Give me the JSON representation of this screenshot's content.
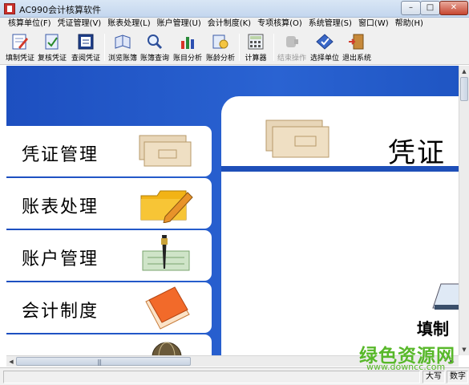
{
  "window": {
    "title": "AC990会计核算软件",
    "minimize_symbol": "–",
    "maximize_symbol": "□",
    "close_symbol": "✕"
  },
  "menu": [
    "核算单位(F)",
    "凭证管理(V)",
    "账表处理(L)",
    "账户管理(U)",
    "会计制度(K)",
    "专项核算(O)",
    "系统管理(S)",
    "窗口(W)",
    "帮助(H)"
  ],
  "toolbar": [
    {
      "label": "填制凭证",
      "icon": "pen-icon",
      "enabled": true
    },
    {
      "label": "复核凭证",
      "icon": "check-document-icon",
      "enabled": true
    },
    {
      "label": "查阅凭证",
      "icon": "view-document-icon",
      "enabled": true
    },
    {
      "label": "浏览账簿",
      "icon": "ledger-book-icon",
      "enabled": true
    },
    {
      "label": "账簿查询",
      "icon": "search-magnifier-icon",
      "enabled": true
    },
    {
      "label": "账目分析",
      "icon": "bar-chart-icon",
      "enabled": true
    },
    {
      "label": "账龄分析",
      "icon": "aging-analysis-icon",
      "enabled": true
    },
    {
      "label": "计算器",
      "icon": "calculator-icon",
      "enabled": true
    },
    {
      "label": "结束操作",
      "icon": "end-operation-icon",
      "enabled": false
    },
    {
      "label": "选择单位",
      "icon": "select-unit-icon",
      "enabled": true
    },
    {
      "label": "退出系统",
      "icon": "exit-door-icon",
      "enabled": true
    }
  ],
  "modules": [
    {
      "label": "凭证管理",
      "icon": "voucher-cards-icon"
    },
    {
      "label": "账表处理",
      "icon": "folder-pencil-icon"
    },
    {
      "label": "账户管理",
      "icon": "pen-checks-icon"
    },
    {
      "label": "会计制度",
      "icon": "notebook-icon"
    },
    {
      "label": "",
      "icon": "globe-icon"
    }
  ],
  "right_panel": {
    "title": "凭证",
    "subtitle": "填制"
  },
  "statusbar": {
    "pane1": "",
    "pane2": "大写",
    "pane3": "数字"
  },
  "watermark": {
    "text": "绿色资源网",
    "url": "www.downcc.com"
  },
  "colors": {
    "main_blue": "#1f55c3",
    "watermark_green": "#58b82a"
  }
}
